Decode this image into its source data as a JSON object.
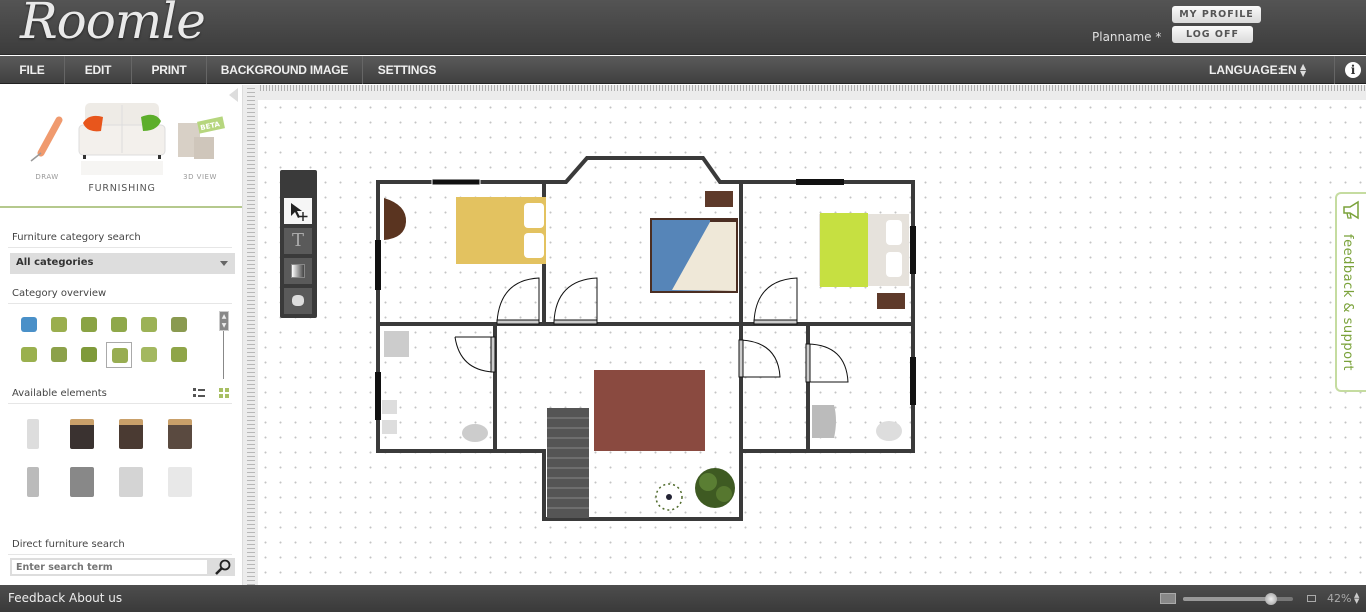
{
  "app": {
    "logo": "Roomle",
    "plan_name": "Planname *"
  },
  "header": {
    "my_profile": "MY PROFILE",
    "log_off": "LOG OFF"
  },
  "menu": {
    "items": [
      {
        "label": "FILE"
      },
      {
        "label": "EDIT"
      },
      {
        "label": "PRINT"
      },
      {
        "label": "BACKGROUND IMAGE"
      },
      {
        "label": "SETTINGS"
      }
    ],
    "language_label": "LANGUAGE:",
    "language_value": "EN",
    "info_icon": "info-icon"
  },
  "sidebar": {
    "modes": [
      {
        "label": "DRAW",
        "icon": "pencil-icon"
      },
      {
        "label": "FURNISHING",
        "icon": "sofa-icon",
        "active": true
      },
      {
        "label": "3D VIEW",
        "icon": "3d-box-icon",
        "badge": "BETA"
      }
    ],
    "category_search_label": "Furniture category search",
    "category_selected": "All categories",
    "category_overview_label": "Category overview",
    "categories": [
      {
        "icon": "bathtub-icon",
        "selected": false
      },
      {
        "icon": "sink-icon",
        "selected": false
      },
      {
        "icon": "toilet-icon",
        "selected": false
      },
      {
        "icon": "kitchen-icon",
        "selected": false
      },
      {
        "icon": "bed-icon",
        "selected": false
      },
      {
        "icon": "chair-icon",
        "selected": false
      },
      {
        "icon": "sofa-icon",
        "selected": false
      },
      {
        "icon": "cabinet-icon",
        "selected": false
      },
      {
        "icon": "plant-icon",
        "selected": false
      },
      {
        "icon": "appliance-icon",
        "selected": true
      },
      {
        "icon": "lamp-icon",
        "selected": false
      },
      {
        "icon": "dresser-icon",
        "selected": false
      }
    ],
    "available_elements_label": "Available elements",
    "elements": [
      {
        "icon": "coat-rack-icon"
      },
      {
        "icon": "oven-dark-icon"
      },
      {
        "icon": "dishwasher-dark-icon"
      },
      {
        "icon": "washer-dark-icon"
      },
      {
        "icon": "fridge-narrow-icon"
      },
      {
        "icon": "fridge-grey-icon"
      },
      {
        "icon": "dishwasher-white-icon"
      },
      {
        "icon": "washing-machine-icon"
      }
    ],
    "direct_search_label": "Direct furniture search",
    "search_placeholder": "Enter search term"
  },
  "tools": [
    {
      "name": "select-move-tool",
      "active": true
    },
    {
      "name": "text-tool",
      "active": false
    },
    {
      "name": "gradient-tool",
      "active": false
    },
    {
      "name": "shape-tool",
      "active": false
    }
  ],
  "feedback_tab": "feedback & support",
  "footer": {
    "feedback": "Feedback",
    "about": "About us",
    "zoom_level": "42%",
    "zoom_fraction": 0.8
  },
  "colors": {
    "accent_green": "#9bbd5a",
    "header_dark": "#444444"
  }
}
